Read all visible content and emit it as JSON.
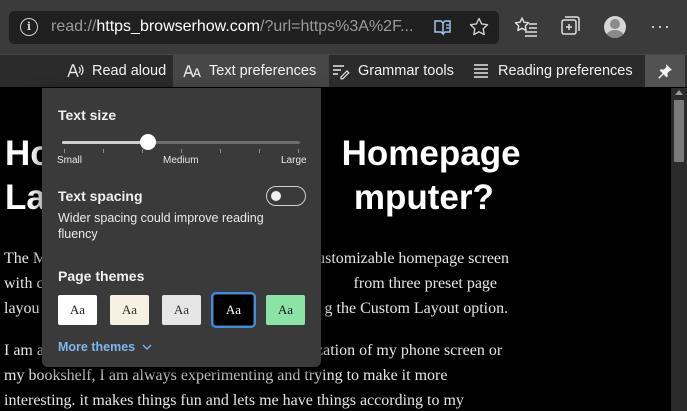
{
  "address_bar": {
    "url_scheme": "read://",
    "url_host": "https_browserhow.com",
    "url_rest": "/?url=https%3A%2F..."
  },
  "reader_toolbar": {
    "read_aloud": "Read aloud",
    "text_preferences": "Text preferences",
    "grammar_tools": "Grammar tools",
    "reading_preferences": "Reading preferences"
  },
  "article": {
    "title_visible_left": "Ho",
    "title_visible_right": "Homepage",
    "title_line2_left": "La",
    "title_line2_right": "mputer?",
    "p1_line1_left": "The M",
    "p1_line1_right": "ustomizable homepage screen",
    "p1_line2_left": "with c",
    "p1_line2_right": "from three preset page",
    "p1_line3_left": "layou",
    "p1_line3_right": "g the Custom Layout option.",
    "p2_line1_left": "I am a",
    "p2_line1_right": "zation of my phone screen or",
    "p2_line2": "my bookshelf, I am always experimenting and trying to make it more",
    "p2_line3": "interesting. it makes things fun and lets me have things according to my"
  },
  "text_preferences_panel": {
    "text_size_label": "Text size",
    "text_size_value": 0.36,
    "scale_small": "Small",
    "scale_medium": "Medium",
    "scale_large": "Large",
    "text_spacing_label": "Text spacing",
    "text_spacing_description": "Wider spacing could improve reading fluency",
    "text_spacing_enabled": false,
    "page_themes_label": "Page themes",
    "themes": [
      {
        "label": "Aa",
        "bg": "#ffffff",
        "fg": "#222222",
        "selected": false
      },
      {
        "label": "Aa",
        "bg": "#f7f1e3",
        "fg": "#333333",
        "selected": false
      },
      {
        "label": "Aa",
        "bg": "#e6e6e6",
        "fg": "#333333",
        "selected": false
      },
      {
        "label": "Aa",
        "bg": "#000000",
        "fg": "#ffffff",
        "selected": true
      },
      {
        "label": "Aa",
        "bg": "#8be3a5",
        "fg": "#1a1a1a",
        "selected": false
      }
    ],
    "more_themes": "More themes"
  },
  "colors": {
    "accent": "#3a8ee6",
    "link": "#7fb6ef"
  }
}
